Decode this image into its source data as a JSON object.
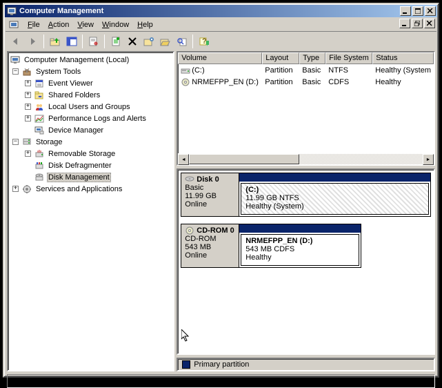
{
  "title": "Computer Management",
  "menus": {
    "file": "File",
    "action": "Action",
    "view": "View",
    "window": "Window",
    "help": "Help"
  },
  "tree": {
    "root": "Computer Management (Local)",
    "system_tools": "System Tools",
    "event_viewer": "Event Viewer",
    "shared_folders": "Shared Folders",
    "local_users": "Local Users and Groups",
    "perf_logs": "Performance Logs and Alerts",
    "device_mgr": "Device Manager",
    "storage": "Storage",
    "removable": "Removable Storage",
    "defrag": "Disk Defragmenter",
    "disk_mgmt": "Disk Management",
    "services": "Services and Applications"
  },
  "list": {
    "cols": {
      "volume": "Volume",
      "layout": "Layout",
      "type": "Type",
      "fs": "File System",
      "status": "Status"
    },
    "rows": [
      {
        "volume": "(C:)",
        "layout": "Partition",
        "type": "Basic",
        "fs": "NTFS",
        "status": "Healthy (System"
      },
      {
        "volume": "NRMEFPP_EN (D:)",
        "layout": "Partition",
        "type": "Basic",
        "fs": "CDFS",
        "status": "Healthy"
      }
    ]
  },
  "disks": {
    "d0": {
      "name": "Disk 0",
      "type": "Basic",
      "size": "11.99 GB",
      "state": "Online",
      "part": {
        "name": "(C:)",
        "info": "11.99 GB NTFS",
        "status": "Healthy (System)"
      }
    },
    "cd": {
      "name": "CD-ROM 0",
      "type": "CD-ROM",
      "size": "543 MB",
      "state": "Online",
      "part": {
        "name": "NRMEFPP_EN (D:)",
        "info": "543 MB CDFS",
        "status": "Healthy"
      }
    }
  },
  "legend": {
    "primary": "Primary partition"
  }
}
